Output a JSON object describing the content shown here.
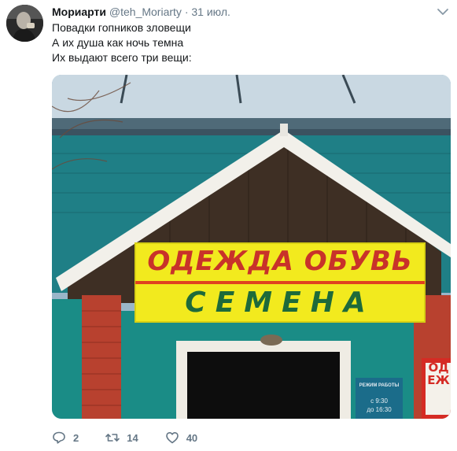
{
  "tweet": {
    "author_name": "Мориарти",
    "author_handle": "@teh_Moriarty",
    "separator": "·",
    "date": "31 июл.",
    "lines": [
      "Повадки гопников зловещи",
      "А их душа как ночь темна",
      "Их выдают всего три вещи:"
    ]
  },
  "media": {
    "sign_line1": "ОДЕЖДА ОБУВЬ",
    "sign_line2": "СЕМЕНА",
    "hours_title": "РЕЖИМ РАБОТЫ",
    "hours_from": "с 9:30",
    "hours_to": "до 16:30",
    "side_sign": "ОДЕЖ"
  },
  "actions": {
    "replies": "2",
    "retweets": "14",
    "likes": "40"
  },
  "colors": {
    "sign_yellow": "#f2ea1e",
    "sign_red": "#c8322a",
    "sign_green": "#1e6a3a",
    "wall_teal": "#1a8c86",
    "brick_red": "#b8412f"
  },
  "icons": [
    "avatar",
    "chevron-down-icon",
    "reply-icon",
    "retweet-icon",
    "heart-icon"
  ]
}
